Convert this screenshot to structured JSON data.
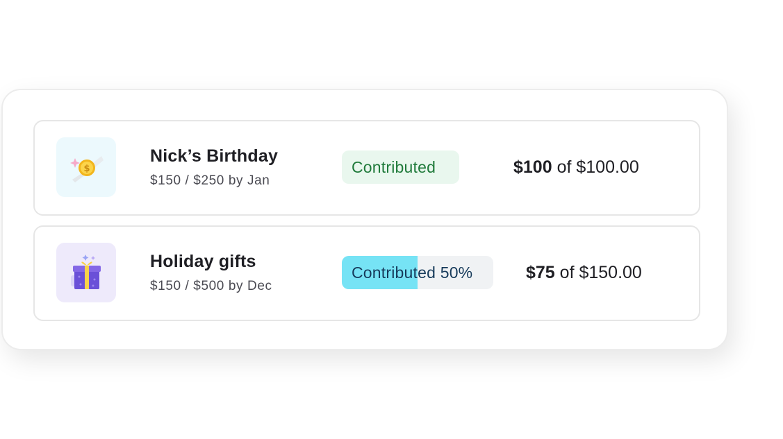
{
  "goals": [
    {
      "title": "Nick’s Birthday",
      "subtitle": "$150 / $250 by Jan",
      "icon": "coin-icon",
      "badge": "Contributed",
      "progress_percent": 100,
      "amount_contributed": "$100",
      "amount_rest": "of $100.00",
      "colors": {
        "thumb_bg": "#ecf9fd",
        "badge_bg": "#e9f7ee",
        "badge_text": "#1f7a3a"
      }
    },
    {
      "title": "Holiday gifts",
      "subtitle": "$150 / $500 by Dec",
      "icon": "gift-icon",
      "badge": "Contributed 50%",
      "progress_percent": 50,
      "amount_contributed": "$75",
      "amount_rest": "of $150.00",
      "colors": {
        "thumb_bg": "#eeeafb",
        "badge_bg": "#f0f2f4",
        "badge_fill": "#76e3f5",
        "badge_text": "#163a5a"
      }
    }
  ]
}
